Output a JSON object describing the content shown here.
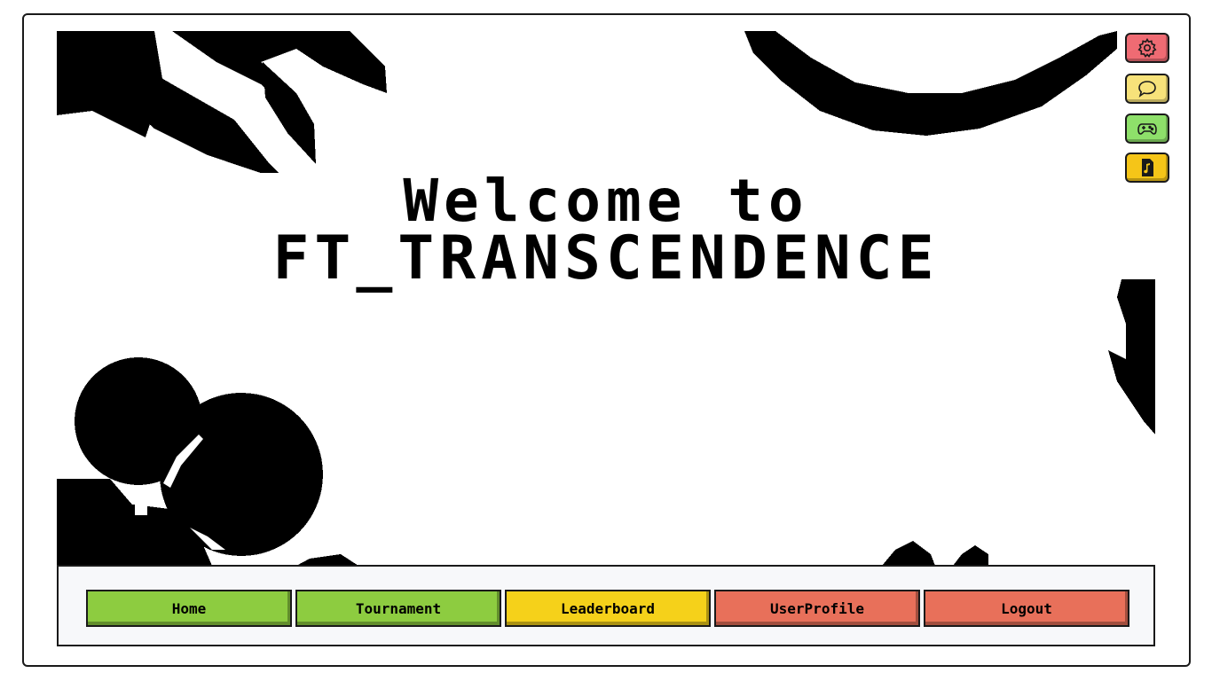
{
  "hero": {
    "line1": "Welcome to",
    "line2": "FT_TRANSCENDENCE"
  },
  "side_buttons": [
    {
      "name": "settings",
      "icon": "gear-icon",
      "color": "#ef6b73"
    },
    {
      "name": "chat",
      "icon": "chat-bubble-icon",
      "color": "#f7e27a"
    },
    {
      "name": "game",
      "icon": "gamepad-icon",
      "color": "#8ee06a"
    },
    {
      "name": "music",
      "icon": "music-file-icon",
      "color": "#f5c518"
    }
  ],
  "nav": {
    "items": [
      {
        "label": "Home",
        "color": "#8dcc40"
      },
      {
        "label": "Tournament",
        "color": "#8dcc40"
      },
      {
        "label": "Leaderboard",
        "color": "#f5d11a"
      },
      {
        "label": "UserProfile",
        "color": "#e8705a"
      },
      {
        "label": "Logout",
        "color": "#e8705a"
      }
    ]
  },
  "colors": {
    "border": "#1a1a1a",
    "background": "#ffffff",
    "decor": "#000000",
    "nav_background": "#f7f8fa"
  }
}
